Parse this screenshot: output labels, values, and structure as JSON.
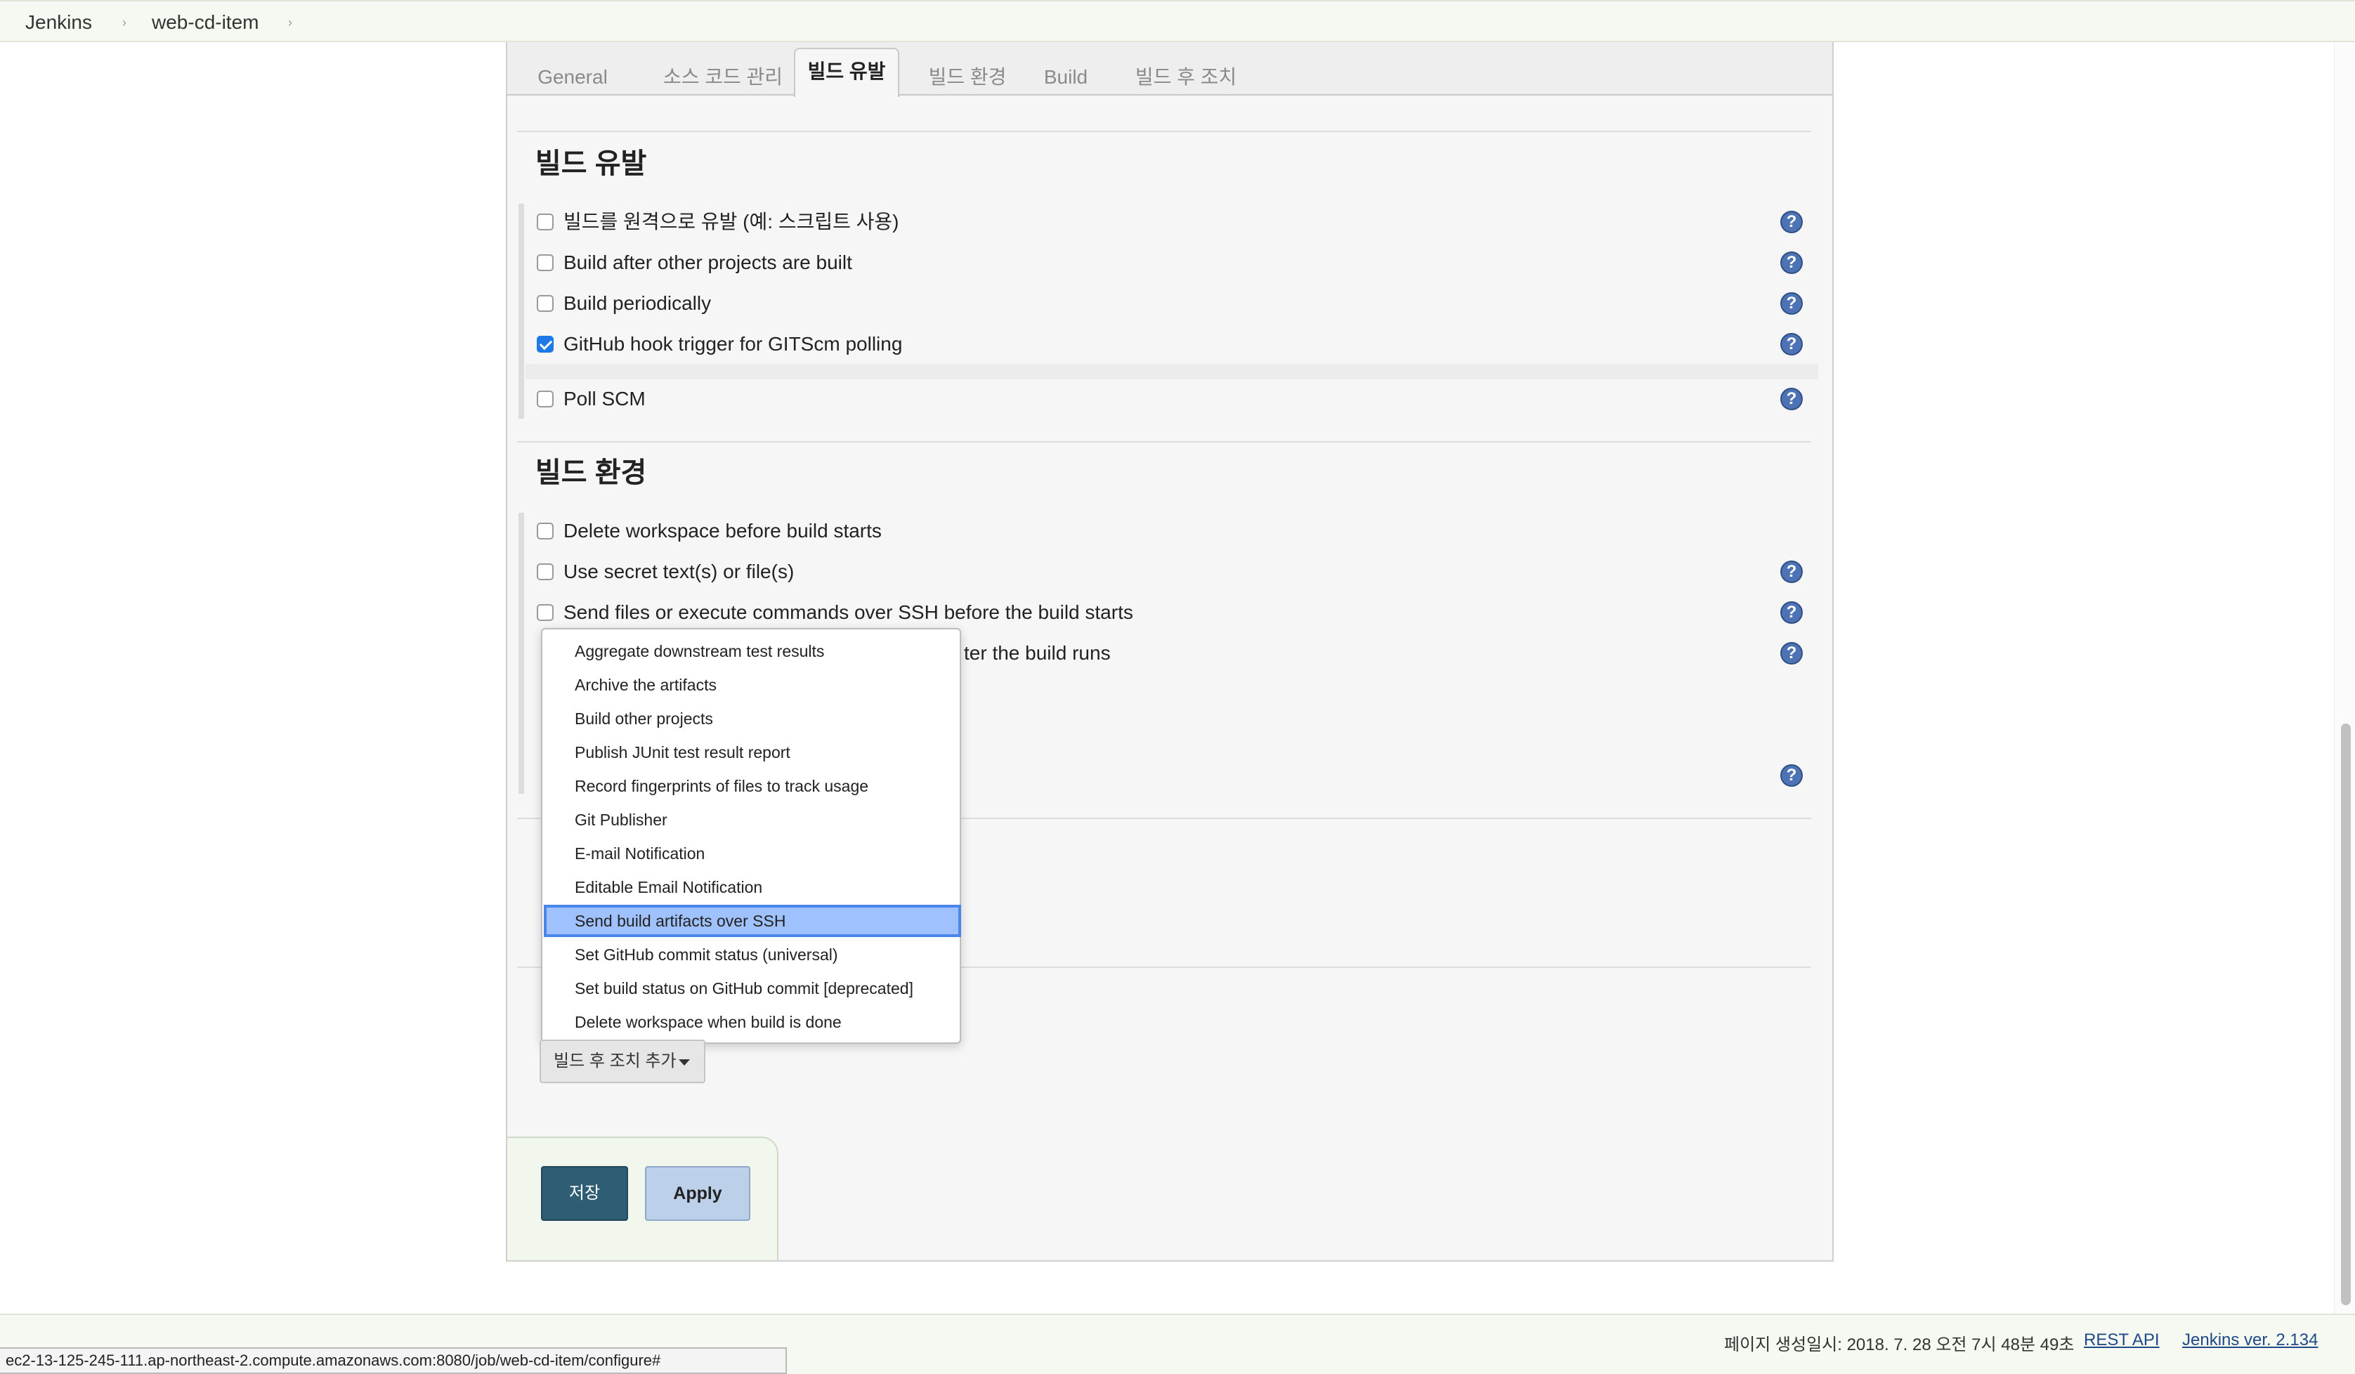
{
  "breadcrumb": {
    "items": [
      "Jenkins",
      "web-cd-item"
    ],
    "separator": "›"
  },
  "tabs": [
    {
      "label": "General",
      "active": false
    },
    {
      "label": "소스 코드 관리",
      "active": false
    },
    {
      "label": "빌드 유발",
      "active": true
    },
    {
      "label": "빌드 환경",
      "active": false
    },
    {
      "label": "Build",
      "active": false
    },
    {
      "label": "빌드 후 조치",
      "active": false
    }
  ],
  "build_triggers": {
    "title": "빌드 유발",
    "options": [
      {
        "label": "빌드를 원격으로 유발 (예: 스크립트 사용)",
        "checked": false
      },
      {
        "label": "Build after other projects are built",
        "checked": false
      },
      {
        "label": "Build periodically",
        "checked": false
      },
      {
        "label": "GitHub hook trigger for GITScm polling",
        "checked": true
      },
      {
        "label": "Poll SCM",
        "checked": false
      }
    ]
  },
  "build_environment": {
    "title": "빌드 환경",
    "options": [
      {
        "label": "Delete workspace before build starts",
        "checked": false
      },
      {
        "label": "Use secret text(s) or file(s)",
        "checked": false
      },
      {
        "label": "Send files or execute commands over SSH before the build starts",
        "checked": false
      },
      {
        "label": "ter the build runs",
        "checked": false
      }
    ]
  },
  "post_build_menu": {
    "items": [
      "Aggregate downstream test results",
      "Archive the artifacts",
      "Build other projects",
      "Publish JUnit test result report",
      "Record fingerprints of files to track usage",
      "Git Publisher",
      "E-mail Notification",
      "Editable Email Notification",
      "Send build artifacts over SSH",
      "Set GitHub commit status (universal)",
      "Set build status on GitHub commit [deprecated]",
      "Delete workspace when build is done"
    ],
    "selected_index": 8,
    "add_button_label": "빌드 후 조치 추가"
  },
  "actions": {
    "save_label": "저장",
    "apply_label": "Apply"
  },
  "footer": {
    "generated": "페이지 생성일시: 2018. 7. 28 오전 7시 48분 49초",
    "rest_api": "REST API",
    "version": "Jenkins ver. 2.134"
  },
  "status_bar": {
    "url": "ec2-13-125-245-111.ap-northeast-2.compute.amazonaws.com:8080/job/web-cd-item/configure#"
  },
  "colors": {
    "accent": "#1f78e8",
    "help_icon": "#4d73b5",
    "save_button": "#2f5d74",
    "apply_button": "#bcd0ea",
    "menu_selected": "#9fc2ff"
  }
}
